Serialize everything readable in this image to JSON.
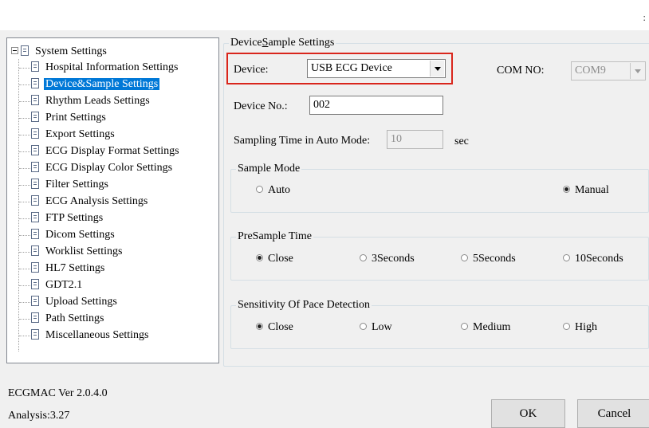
{
  "window": {
    "corner_mark": ":"
  },
  "tree": {
    "root": "System Settings",
    "items": [
      "Hospital Information Settings",
      "Device&Sample Settings",
      "Rhythm Leads Settings",
      "Print Settings",
      "Export Settings",
      "ECG Display Format Settings",
      "ECG Display Color Settings",
      "Filter Settings",
      "ECG Analysis Settings",
      "FTP Settings",
      "Dicom Settings",
      "Worklist Settings",
      "HL7 Settings",
      "GDT2.1",
      "Upload Settings",
      "Path Settings",
      "Miscellaneous Settings"
    ],
    "selected_index": 1
  },
  "device_sample": {
    "group_title_pre": "Device",
    "group_title_mnemonic": "S",
    "group_title_post": "ample Settings",
    "device_label": "Device:",
    "device_value": "USB ECG Device",
    "com_label": "COM NO:",
    "com_value": "COM9",
    "device_no_label": "Device No.:",
    "device_no_value": "002",
    "sampling_label": "Sampling Time in Auto Mode:",
    "sampling_value": "10",
    "sampling_unit": "sec"
  },
  "sample_mode": {
    "title": "Sample Mode",
    "options": [
      "Auto",
      "Manual"
    ],
    "selected": "Manual"
  },
  "presample_time": {
    "title": "PreSample Time",
    "options": [
      "Close",
      "3Seconds",
      "5Seconds",
      "10Seconds"
    ],
    "selected": "Close"
  },
  "pace_detection": {
    "title": "Sensitivity Of Pace Detection",
    "options": [
      "Close",
      "Low",
      "Medium",
      "High"
    ],
    "selected": "Close"
  },
  "footer": {
    "version": "ECGMAC Ver 2.0.4.0",
    "analysis": "Analysis:3.27",
    "ok_label": "OK",
    "cancel_label": "Cancel"
  },
  "colors": {
    "highlight": "#d9261c",
    "selection": "#0078d7"
  }
}
